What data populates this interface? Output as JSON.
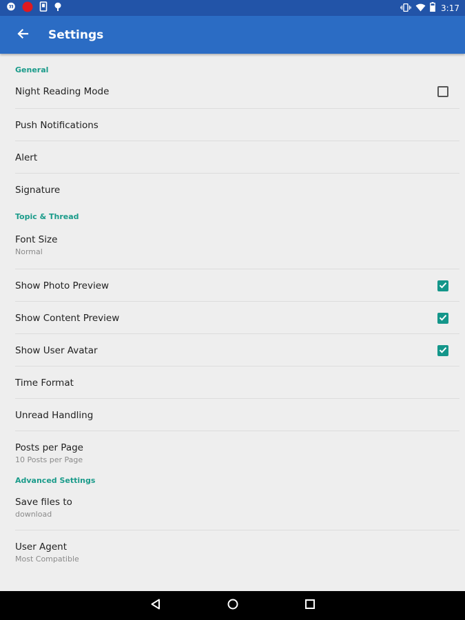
{
  "status_bar": {
    "time": "3:17",
    "left_icons": [
      "hangouts-icon",
      "record-icon",
      "phone-icon",
      "notification-icon"
    ],
    "right_icons": [
      "vibrate-icon",
      "wifi-icon",
      "battery-icon"
    ]
  },
  "app_bar": {
    "title": "Settings",
    "back_icon": "arrow-back-icon",
    "color": "#2b6cc4"
  },
  "sections": {
    "general": {
      "header": "General",
      "night_reading": {
        "title": "Night Reading Mode",
        "checked": false
      },
      "push_notifications": {
        "title": "Push Notifications"
      },
      "alert": {
        "title": "Alert"
      },
      "signature": {
        "title": "Signature"
      }
    },
    "topic_thread": {
      "header": "Topic & Thread",
      "font_size": {
        "title": "Font Size",
        "summary": "Normal"
      },
      "photo_preview": {
        "title": "Show Photo Preview",
        "checked": true
      },
      "content_preview": {
        "title": "Show Content Preview",
        "checked": true
      },
      "user_avatar": {
        "title": "Show User Avatar",
        "checked": true
      },
      "time_format": {
        "title": "Time Format"
      },
      "unread_handling": {
        "title": "Unread Handling"
      },
      "posts_per_page": {
        "title": "Posts per Page",
        "summary": "10 Posts per Page"
      }
    },
    "advanced": {
      "header": "Advanced Settings",
      "save_files": {
        "title": "Save files to",
        "summary": "download"
      },
      "user_agent": {
        "title": "User Agent",
        "summary": "Most Compatible"
      }
    }
  },
  "nav_bar": {
    "icons": [
      "nav-back-icon",
      "nav-home-icon",
      "nav-recents-icon"
    ]
  },
  "colors": {
    "accent": "#14968a",
    "section_header": "#1a9b8a",
    "status_bar": "#2254a8",
    "background": "#eeeeee"
  }
}
